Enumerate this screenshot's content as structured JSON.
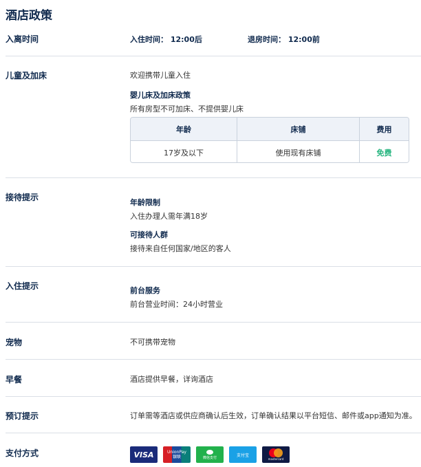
{
  "title": "酒店政策",
  "checkin": {
    "label": "入离时间",
    "in_label": "入住时间：",
    "in_time": "12:00后",
    "out_label": "退房时间：",
    "out_time": "12:00前"
  },
  "children": {
    "label": "儿童及加床",
    "welcome": "欢迎携带儿童入住",
    "policy_title": "婴儿床及加床政策",
    "policy_text": "所有房型不可加床、不提供婴儿床",
    "table": {
      "headers": [
        "年龄",
        "床铺",
        "费用"
      ],
      "rows": [
        {
          "age": "17岁及以下",
          "bed": "使用现有床铺",
          "fee": "免费"
        }
      ]
    },
    "colors": {
      "free": "#24b47e"
    }
  },
  "reception": {
    "label": "接待提示",
    "age_title": "年龄限制",
    "age_text": "入住办理人需年满18岁",
    "guests_title": "可接待人群",
    "guests_text": "接待来自任何国家/地区的客人"
  },
  "checkin_tips": {
    "label": "入住提示",
    "desk_title": "前台服务",
    "desk_text": "前台营业时间：24小时营业"
  },
  "pets": {
    "label": "宠物",
    "text": "不可携带宠物"
  },
  "breakfast": {
    "label": "早餐",
    "text": "酒店提供早餐，详询酒店"
  },
  "booking": {
    "label": "预订提示",
    "text": "订单需等酒店或供应商确认后生效，订单确认结果以平台短信、邮件或app通知为准。"
  },
  "payment": {
    "label": "支付方式",
    "methods": [
      {
        "name": "VISA",
        "icon": "visa-icon"
      },
      {
        "name": "UnionPay 银联",
        "icon": "unionpay-icon",
        "line1": "UnionPay",
        "line2": "银联"
      },
      {
        "name": "微信支付",
        "icon": "wechat-pay-icon"
      },
      {
        "name": "支付宝",
        "icon": "alipay-icon"
      },
      {
        "name": "mastercard",
        "icon": "mastercard-icon"
      }
    ]
  }
}
